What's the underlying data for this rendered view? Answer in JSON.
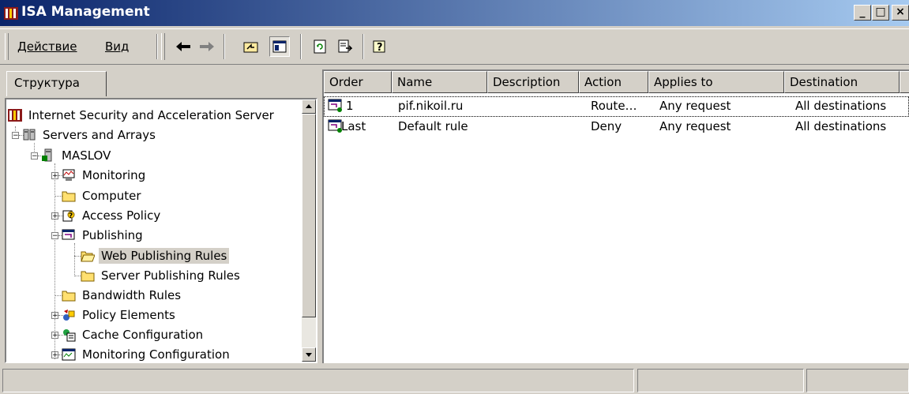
{
  "window": {
    "title": "ISA Management",
    "brand_color": "#0a246a",
    "icon": "isa-server-icon"
  },
  "window_controls": {
    "minimize": "_",
    "maximize": "□",
    "close": "×"
  },
  "menu": {
    "action": "Действие",
    "view": "Вид"
  },
  "toolbar": {
    "buttons": [
      "back-icon",
      "forward-icon",
      "up-level-icon",
      "show-hide-tree-icon",
      "refresh-icon",
      "export-list-icon",
      "help-icon"
    ]
  },
  "tabs": {
    "structure": "Структура"
  },
  "tree": {
    "items": [
      {
        "label": "Internet Security and Acceleration Server",
        "icon": "isa-server-icon"
      },
      {
        "label": "Servers and Arrays",
        "icon": "servers-icon",
        "expanded": true
      },
      {
        "label": "MASLOV",
        "icon": "server-icon",
        "expanded": true
      },
      {
        "label": "Monitoring",
        "icon": "monitoring-icon"
      },
      {
        "label": "Computer",
        "icon": "folder-icon"
      },
      {
        "label": "Access Policy",
        "icon": "access-policy-icon"
      },
      {
        "label": "Publishing",
        "icon": "publishing-icon",
        "expanded": true
      },
      {
        "label": "Web Publishing Rules",
        "icon": "open-folder-icon",
        "selected": true
      },
      {
        "label": "Server Publishing Rules",
        "icon": "folder-icon"
      },
      {
        "label": "Bandwidth Rules",
        "icon": "folder-icon"
      },
      {
        "label": "Policy Elements",
        "icon": "policy-elements-icon"
      },
      {
        "label": "Cache Configuration",
        "icon": "cache-icon"
      },
      {
        "label": "Monitoring Configuration",
        "icon": "monitoring-config-icon"
      }
    ]
  },
  "list": {
    "columns": [
      "Order",
      "Name",
      "Description",
      "Action",
      "Applies to",
      "Destination"
    ],
    "rows": [
      {
        "order": "1",
        "name": "pif.nikoil.ru",
        "description": "",
        "action": "Route…",
        "applies_to": "Any request",
        "destination": "All destinations",
        "icon": "web-rule-icon"
      },
      {
        "order": "Last",
        "name": "Default rule",
        "description": "",
        "action": "Deny",
        "applies_to": "Any request",
        "destination": "All destinations",
        "icon": "web-rule-icon"
      }
    ]
  }
}
